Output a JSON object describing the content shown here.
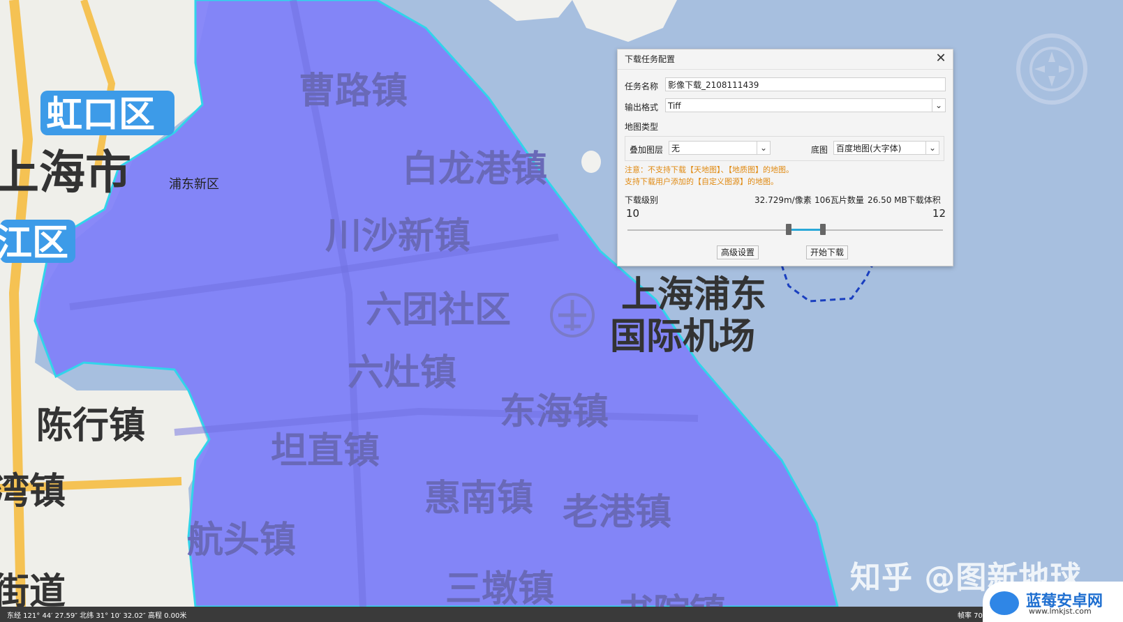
{
  "map": {
    "districts": {
      "hongkou": "虹口区",
      "pudong": "浦东新区",
      "shanghai_city": "上海市",
      "partial_qu": "江区"
    },
    "towns": {
      "caolu": "曹路镇",
      "bailonggang": "白龙港镇",
      "chuansha": "川沙新镇",
      "liutuan": "六团社区",
      "liuzao": "六灶镇",
      "donghai": "东海镇",
      "tanzhi": "坦直镇",
      "huinan": "惠南镇",
      "laogang": "老港镇",
      "hangtou": "航头镇",
      "sandun": "三墩镇",
      "shuyuan": "书院镇",
      "chenhang": "陈行镇",
      "partial_wan": "湾镇",
      "partial_street": "街道"
    },
    "airport_line1": "上海浦东",
    "airport_line2": "国际机场"
  },
  "dialog": {
    "title": "下载任务配置",
    "close_icon": "close-icon",
    "task_name_label": "任务名称",
    "task_name_value": "影像下载_2108111439",
    "output_format_label": "输出格式",
    "output_format_value": "Tiff",
    "map_type_label": "地图类型",
    "overlay_label": "叠加图层",
    "overlay_value": "无",
    "basemap_label": "底图",
    "basemap_value": "百度地图(大字体)",
    "note_line1": "注意：不支持下载【天地图】、【地质图】的地图。",
    "note_line2": "支持下载用户添加的【自定义图源】的地图。",
    "level_label": "下载级别",
    "resolution": "32.729m/像素",
    "tile_count": "106瓦片数量",
    "volume": "26.50 MB下载体积",
    "level_min": "10",
    "level_max": "12",
    "slider_low_fraction": 0.51,
    "slider_high_fraction": 0.62,
    "advanced_button": "高级设置",
    "start_button": "开始下载"
  },
  "status": {
    "coords": "东经 121° 44′ 27.59″ 北纬 31° 10′ 32.02″ 高程 0.00米",
    "fps": "帧率 70"
  },
  "watermark": "知乎 @图新地球",
  "brand": {
    "name": "蓝莓安卓网",
    "url": "www.lmkjst.com"
  },
  "colors": {
    "sea": "#a7bfdf",
    "land": "#efefea",
    "region_fill": "#8080f8",
    "region_border": "#31d4ea",
    "road": "#f5c253",
    "label_bg": "#3d9be8",
    "note": "#e08a12"
  }
}
